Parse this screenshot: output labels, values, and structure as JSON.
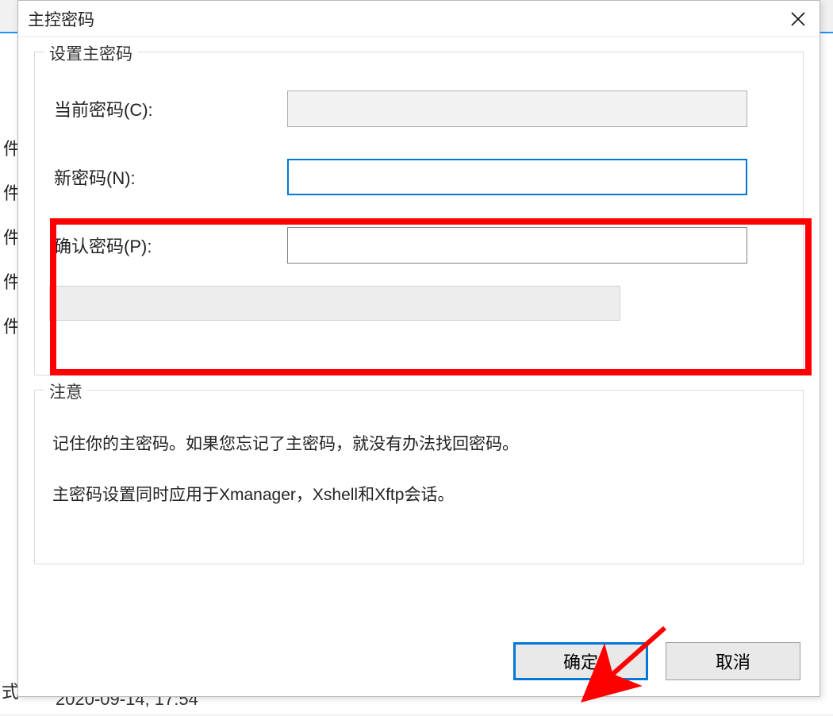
{
  "titlebar": {
    "title": "主控密码",
    "close_icon": "close-icon"
  },
  "group1": {
    "legend": "设置主密码",
    "current_pw_label": "当前密码(C):",
    "new_pw_label": "新密码(N):",
    "confirm_pw_label": "确认密码(P):",
    "current_pw_value": "",
    "new_pw_value": "",
    "confirm_pw_value": ""
  },
  "group2": {
    "legend": "注意",
    "note_line1": "记住你的主密码。如果您忘记了主密码，就没有办法找回密码。",
    "note_line2": "主密码设置同时应用于Xmanager，Xshell和Xftp会话。"
  },
  "buttons": {
    "ok": "确定",
    "cancel": "取消"
  },
  "background": {
    "row_suffix": "件",
    "mode_suffix": "式",
    "date_text": "2020-09-14, 17:54"
  },
  "annotations": {
    "red_highlight": true,
    "arrow_color": "#ff0000"
  }
}
